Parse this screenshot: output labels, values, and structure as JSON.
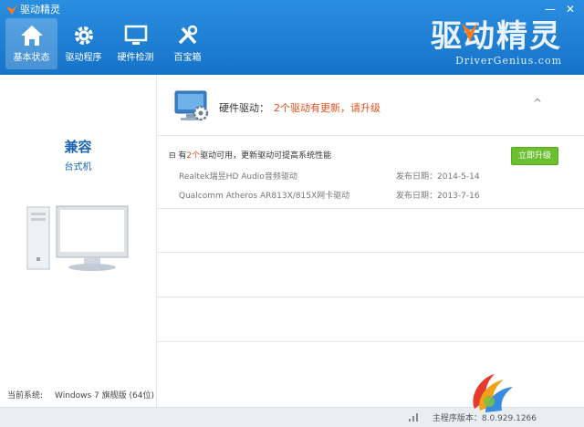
{
  "app": {
    "title": "驱动精灵"
  },
  "window_controls": {
    "minimize": "—",
    "close": "✕"
  },
  "nav": [
    {
      "label": "基本状态",
      "icon": "home-icon"
    },
    {
      "label": "驱动程序",
      "icon": "gear-icon"
    },
    {
      "label": "硬件检测",
      "icon": "monitor-icon"
    },
    {
      "label": "百宝箱",
      "icon": "tools-icon"
    }
  ],
  "brand": {
    "cn": "驱动精灵",
    "en": "DriverGenius.com"
  },
  "left": {
    "status": "兼容",
    "device_type": "台式机",
    "os_label": "当前系统:",
    "os_value": "Windows 7 旗舰版 (64位)"
  },
  "hardware": {
    "label": "硬件驱动：",
    "status": "2个驱动有更新，请升级",
    "collapse_icon": "^",
    "summary_prefix": "有",
    "summary_count": "2个",
    "summary_suffix": "驱动可用，更新驱动可提高系统性能",
    "upgrade_button": "立即升级",
    "drivers": [
      {
        "name": "Realtek瑞昱HD Audio音频驱动",
        "date": "发布日期：2014-5-14"
      },
      {
        "name": "Qualcomm Atheros AR813X/815X网卡驱动",
        "date": "发布日期：2013-7-16"
      }
    ]
  },
  "status": {
    "version": "主程序版本：8.0.929.1266"
  },
  "colors": {
    "titlebar": "#1a7ad4",
    "accent_blue": "#1b63b3",
    "warning": "#e8501e",
    "upgrade_green": "#6ac02f"
  }
}
